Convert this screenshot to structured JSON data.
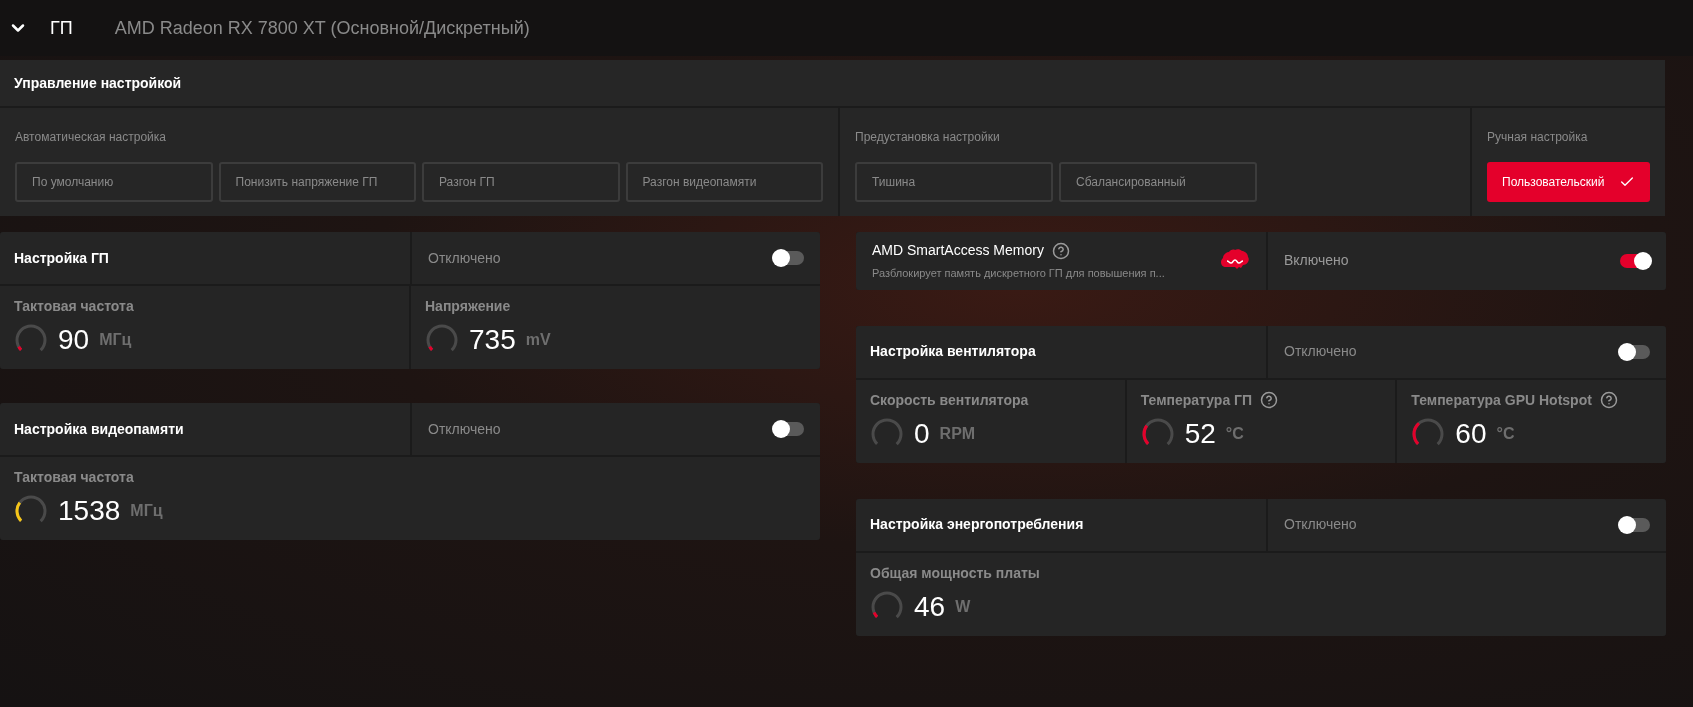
{
  "header": {
    "title": "ГП",
    "device": "AMD Radeon RX 7800 XT (Основной/Дискретный)"
  },
  "tuning_control": {
    "title": "Управление настройкой",
    "groups": [
      {
        "label": "Автоматическая настройка",
        "options": [
          {
            "label": "По умолчанию",
            "selected": false
          },
          {
            "label": "Понизить напряжение ГП",
            "selected": false
          },
          {
            "label": "Разгон ГП",
            "selected": false
          },
          {
            "label": "Разгон видеопамяти",
            "selected": false
          }
        ]
      },
      {
        "label": "Предустановка настройки",
        "options": [
          {
            "label": "Тишина",
            "selected": false
          },
          {
            "label": "Сбалансированный",
            "selected": false
          }
        ]
      },
      {
        "label": "Ручная настройка",
        "options": [
          {
            "label": "Пользовательский",
            "selected": true
          }
        ]
      }
    ]
  },
  "left_column": [
    {
      "kind": "tuning",
      "title": "Настройка ГП",
      "status": "Отключено",
      "on": false,
      "metrics": [
        {
          "label": "Тактовая частота",
          "value": "90",
          "unit": "МГц",
          "level": 0.06,
          "color": "#e4002b",
          "help": false
        },
        {
          "label": "Напряжение",
          "value": "735",
          "unit": "mV",
          "level": 0.06,
          "color": "#e4002b",
          "help": false
        }
      ]
    },
    {
      "kind": "tuning",
      "title": "Настройка видеопамяти",
      "status": "Отключено",
      "on": false,
      "metrics": [
        {
          "label": "Тактовая частота",
          "value": "1538",
          "unit": "МГц",
          "level": 0.3,
          "color": "#f5c518",
          "help": false
        }
      ]
    }
  ],
  "right_column": [
    {
      "kind": "feature",
      "title": "AMD SmartAccess Memory",
      "description": "Разблокирует память дискретного ГП для повышения п...",
      "status": "Включено",
      "on": true
    },
    {
      "kind": "tuning",
      "title": "Настройка вентилятора",
      "status": "Отключено",
      "on": false,
      "metrics": [
        {
          "label": "Скорость вентилятора",
          "value": "0",
          "unit": "RPM",
          "level": 0,
          "help": false
        },
        {
          "label": "Температура ГП",
          "value": "52",
          "unit": "°C",
          "level": 0.3,
          "color": "#e4002b",
          "help": true
        },
        {
          "label": "Температура GPU Hotspot",
          "value": "60",
          "unit": "°C",
          "level": 0.35,
          "color": "#e4002b",
          "help": true
        }
      ]
    },
    {
      "kind": "tuning",
      "title": "Настройка энергопотребления",
      "status": "Отключено",
      "on": false,
      "metrics": [
        {
          "label": "Общая мощность платы",
          "value": "46",
          "unit": "W",
          "level": 0.08,
          "color": "#e4002b",
          "help": false
        }
      ]
    }
  ]
}
